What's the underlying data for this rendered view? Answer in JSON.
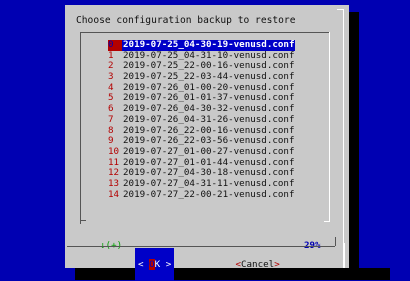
{
  "dialog": {
    "title": "Choose configuration backup to restore",
    "items": [
      {
        "num": "0",
        "file": "2019-07-25_04-30-19-venusd.conf"
      },
      {
        "num": "1",
        "file": "2019-07-25_04-31-10-venusd.conf"
      },
      {
        "num": "2",
        "file": "2019-07-25_22-00-16-venusd.conf"
      },
      {
        "num": "3",
        "file": "2019-07-25_22-03-44-venusd.conf"
      },
      {
        "num": "4",
        "file": "2019-07-26_01-00-20-venusd.conf"
      },
      {
        "num": "5",
        "file": "2019-07-26_01-01-37-venusd.conf"
      },
      {
        "num": "6",
        "file": "2019-07-26_04-30-32-venusd.conf"
      },
      {
        "num": "7",
        "file": "2019-07-26_04-31-26-venusd.conf"
      },
      {
        "num": "8",
        "file": "2019-07-26_22-00-16-venusd.conf"
      },
      {
        "num": "9",
        "file": "2019-07-26_22-03-56-venusd.conf"
      },
      {
        "num": "10",
        "file": "2019-07-27_01-00-27-venusd.conf"
      },
      {
        "num": "11",
        "file": "2019-07-27_01-01-44-venusd.conf"
      },
      {
        "num": "12",
        "file": "2019-07-27_04-30-18-venusd.conf"
      },
      {
        "num": "13",
        "file": "2019-07-27_04-31-11-venusd.conf"
      },
      {
        "num": "14",
        "file": "2019-07-27_22-00-21-venusd.conf"
      }
    ],
    "scroll_indicator": "↓(+)",
    "scroll_percent": "29%",
    "ok_left": "< ",
    "ok_key": "O",
    "ok_rest": "K >",
    "cancel_open": "<",
    "cancel_label": "Cancel",
    "cancel_close": ">"
  },
  "colors": {
    "background": "#0000b2",
    "dialog": "#c9c9c9",
    "hotkey": "#b30000",
    "selection": "#0000c8"
  }
}
